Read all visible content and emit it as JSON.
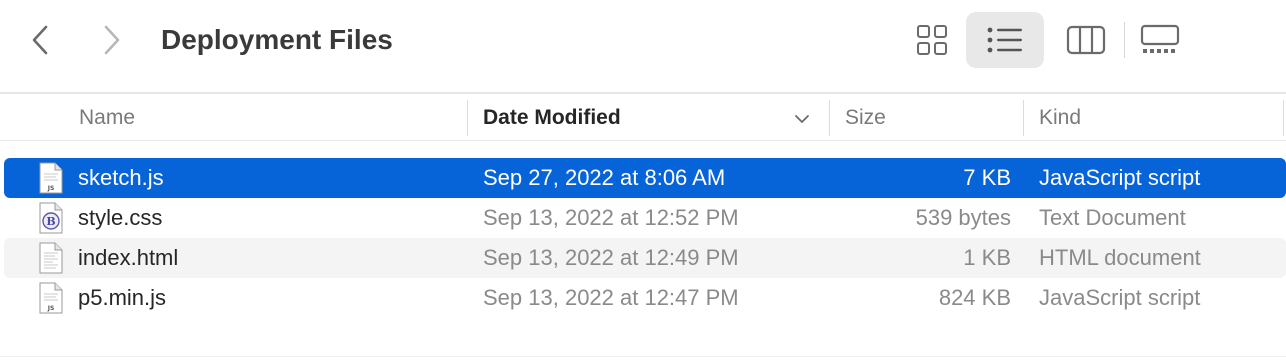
{
  "window": {
    "title": "Deployment Files"
  },
  "toolbar": {
    "back_icon": "chevron-left-icon",
    "forward_icon": "chevron-right-icon",
    "view_modes": [
      "icon-view",
      "list-view",
      "column-view",
      "gallery-view"
    ],
    "active_view": "list-view"
  },
  "columns": {
    "name": "Name",
    "date": "Date Modified",
    "size": "Size",
    "kind": "Kind",
    "sorted_by": "Date Modified"
  },
  "files": [
    {
      "name": "sketch.js",
      "date": "Sep 27, 2022 at 8:06 AM",
      "size": "7 KB",
      "kind": "JavaScript script",
      "icon": "js-file-icon",
      "selected": true
    },
    {
      "name": "style.css",
      "date": "Sep 13, 2022 at 12:52 PM",
      "size": "539 bytes",
      "kind": "Text Document",
      "icon": "css-file-icon",
      "selected": false
    },
    {
      "name": "index.html",
      "date": "Sep 13, 2022 at 12:49 PM",
      "size": "1 KB",
      "kind": "HTML document",
      "icon": "html-file-icon",
      "selected": false
    },
    {
      "name": "p5.min.js",
      "date": "Sep 13, 2022 at 12:47 PM",
      "size": "824 KB",
      "kind": "JavaScript script",
      "icon": "js-file-icon",
      "selected": false
    }
  ],
  "colors": {
    "selection": "#0764d8",
    "alt_row": "#f4f4f4"
  }
}
